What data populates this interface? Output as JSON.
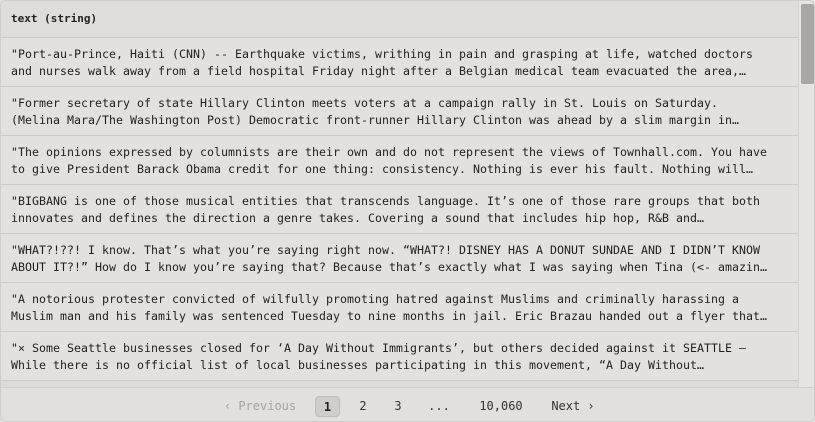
{
  "column": {
    "header": "text (string)"
  },
  "rows": [
    {
      "line1": "\"Port-au-Prince, Haiti (CNN) -- Earthquake victims, writhing in pain and grasping at life, watched doctors",
      "line2": "and nurses walk away from a field hospital Friday night after a Belgian medical team evacuated the area,…"
    },
    {
      "line1": "\"Former secretary of state Hillary Clinton meets voters at a campaign rally in St. Louis on Saturday.",
      "line2": "(Melina Mara/The Washington Post) Democratic front-runner Hillary Clinton was ahead by a slim margin in…"
    },
    {
      "line1": "\"The opinions expressed by columnists are their own and do not represent the views of Townhall.com. You have",
      "line2": "to give President Barack Obama credit for one thing: consistency. Nothing is ever his fault. Nothing will…"
    },
    {
      "line1": "\"BIGBANG is one of those musical entities that transcends language. It’s one of those rare groups that both",
      "line2": "innovates and defines the direction a genre takes. Covering a sound that includes hip hop, R&B and…"
    },
    {
      "line1": "\"WHAT?!??! I know. That’s what you’re saying right now. “WHAT?! DISNEY HAS A DONUT SUNDAE AND I DIDN’T KNOW",
      "line2": "ABOUT IT?!” How do I know you’re saying that? Because that’s exactly what I was saying when Tina (<- amazin…"
    },
    {
      "line1": "\"A notorious protester convicted of wilfully promoting hatred against Muslims and criminally harassing a",
      "line2": "Muslim man and his family was sentenced Tuesday to nine months in jail. Eric Brazau handed out a flyer that…"
    },
    {
      "line1": "\"× Some Seattle businesses closed for ‘A Day Without Immigrants’, but others decided against it SEATTLE —",
      "line2": "While there is no official list of local businesses participating in this movement, “A Day Without…"
    }
  ],
  "pagination": {
    "previous": "‹ Previous",
    "pages": [
      "1",
      "2",
      "3"
    ],
    "ellipsis": "...",
    "last_page": "10,060",
    "next": "Next ›",
    "current_page": "1"
  }
}
